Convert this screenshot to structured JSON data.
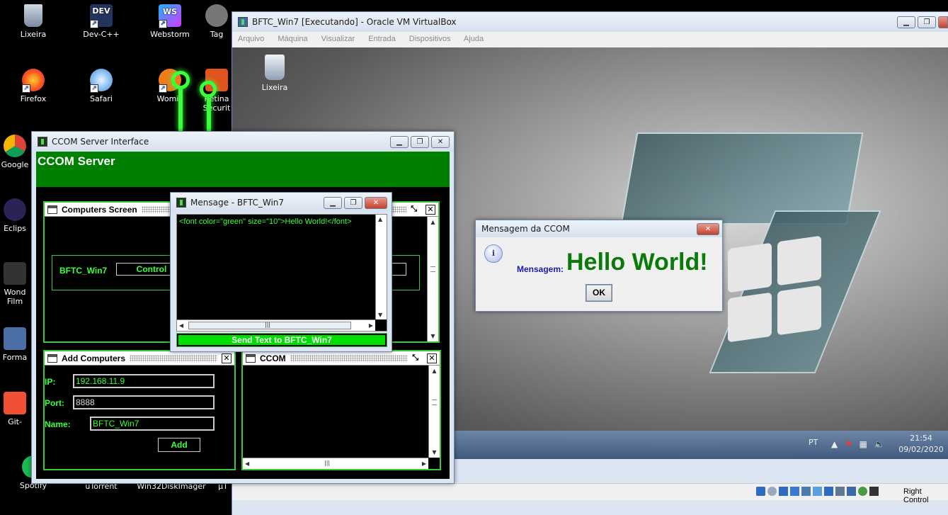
{
  "desktop_icons": [
    {
      "label": "Lixeira",
      "icon": "recycle-bin-icon"
    },
    {
      "label": "Dev-C++",
      "icon": "devcpp-icon"
    },
    {
      "label": "Webstorm",
      "icon": "webstorm-icon"
    },
    {
      "label": "Tag",
      "icon": "tag-icon"
    },
    {
      "label": "Firefox",
      "icon": "firefox-icon"
    },
    {
      "label": "Safari",
      "icon": "safari-icon"
    },
    {
      "label": "Womic",
      "icon": "womic-icon"
    },
    {
      "label": "Retina Securit",
      "icon": "retina-icon"
    },
    {
      "label": "Google",
      "icon": "chrome-icon"
    },
    {
      "label": "Eclips",
      "icon": "eclipse-icon"
    },
    {
      "label": "Wond Film",
      "icon": "wondershare-icon"
    },
    {
      "label": "Forma",
      "icon": "format-icon"
    },
    {
      "label": "Git-",
      "icon": "git-icon"
    },
    {
      "label": "Spotify",
      "icon": "spotify-icon"
    },
    {
      "label": "uTorrent",
      "icon": "utorrent-icon"
    },
    {
      "label": "Win32DiskImager",
      "icon": "diskimager-icon"
    },
    {
      "label": "µT",
      "icon": "utorrent-icon"
    }
  ],
  "vm": {
    "title": "BFTC_Win7 [Executando] - Oracle VM VirtualBox",
    "menu": [
      "Arquivo",
      "Máquina",
      "Visualizar",
      "Entrada",
      "Dispositivos",
      "Ajuda"
    ],
    "guest_icon_label": "Lixeira",
    "tray_lang": "PT",
    "clock_time": "21:54",
    "clock_date": "09/02/2020",
    "status_right": "Right Control"
  },
  "msgbox": {
    "title": "Mensagem da CCOM",
    "label": "Mensagem:",
    "message": "Hello World!",
    "ok": "OK",
    "message_color": "#0a7a0a"
  },
  "ccom": {
    "title": "CCOM Server Interface",
    "header": "CCOM Server",
    "accent": "#008000",
    "computers_screen": {
      "title": "Computers Screen",
      "computer_name": "BFTC_Win7",
      "control_label": "Control"
    },
    "add_computers": {
      "title": "Add Computers",
      "ip_label": "IP:",
      "ip_value": "192.168.11.9",
      "port_label": "Port:",
      "port_value": "8888",
      "name_label": "Name:",
      "name_value": "BFTC_Win7",
      "add_label": "Add"
    },
    "ccom_panel": {
      "title": "CCOM"
    }
  },
  "mensage": {
    "title": "Mensage - BFTC_Win7",
    "text": "<font color=\"green\" size=\"10\">Hello World!</font>",
    "send_label": "Send Text to BFTC_Win7"
  }
}
